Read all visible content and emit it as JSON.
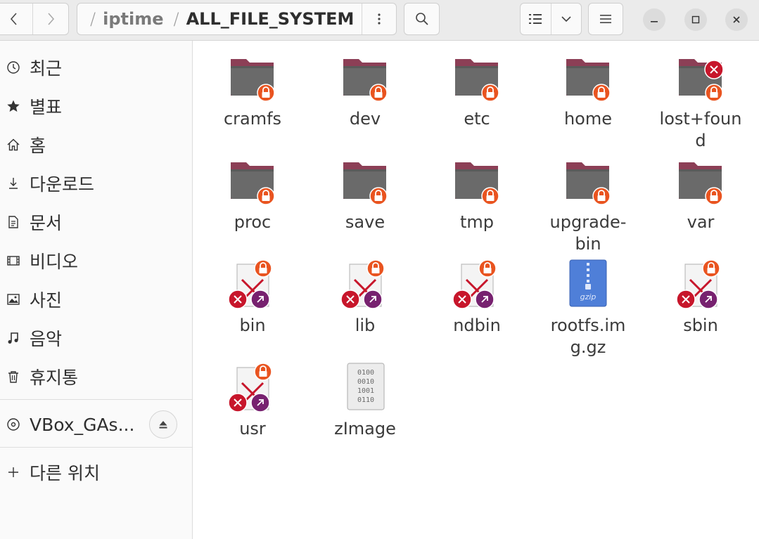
{
  "header": {
    "path": [
      "iptime",
      "ALL_FILE_SYSTEM"
    ],
    "back_icon": "chevron-left-icon",
    "forward_icon": "chevron-right-icon"
  },
  "sidebar": {
    "places": [
      {
        "label": "최근",
        "icon": "clock-icon"
      },
      {
        "label": "별표",
        "icon": "star-icon"
      },
      {
        "label": "홈",
        "icon": "home-icon"
      },
      {
        "label": "다운로드",
        "icon": "download-icon"
      },
      {
        "label": "문서",
        "icon": "document-icon"
      },
      {
        "label": "비디오",
        "icon": "video-icon"
      },
      {
        "label": "사진",
        "icon": "image-icon"
      },
      {
        "label": "음악",
        "icon": "music-icon"
      },
      {
        "label": "휴지통",
        "icon": "trash-icon"
      }
    ],
    "device": {
      "label": "VBox_GAs...",
      "icon": "disc-icon"
    },
    "other": {
      "label": "다른 위치",
      "icon": "plus-icon"
    }
  },
  "files": [
    {
      "name": "cramfs",
      "type": "folder-locked"
    },
    {
      "name": "dev",
      "type": "folder-locked"
    },
    {
      "name": "etc",
      "type": "folder-locked"
    },
    {
      "name": "home",
      "type": "folder-locked"
    },
    {
      "name": "lost+found",
      "type": "folder-locked-denied"
    },
    {
      "name": "proc",
      "type": "folder-locked"
    },
    {
      "name": "save",
      "type": "folder-locked"
    },
    {
      "name": "tmp",
      "type": "folder-locked"
    },
    {
      "name": "upgrade-bin",
      "type": "folder-locked"
    },
    {
      "name": "var",
      "type": "folder-locked"
    },
    {
      "name": "bin",
      "type": "broken-link"
    },
    {
      "name": "lib",
      "type": "broken-link"
    },
    {
      "name": "ndbin",
      "type": "broken-link"
    },
    {
      "name": "rootfs.img.gz",
      "type": "archive-gzip"
    },
    {
      "name": "sbin",
      "type": "broken-link"
    },
    {
      "name": "usr",
      "type": "broken-link"
    },
    {
      "name": "zImage",
      "type": "binary-file"
    }
  ],
  "colors": {
    "folder_top": "#8c3f56",
    "folder_body": "#6a6a6a",
    "lock_badge": "#e95420",
    "error_badge": "#c7162b",
    "link_badge": "#77216f",
    "archive_blue": "#4f7fd8"
  }
}
